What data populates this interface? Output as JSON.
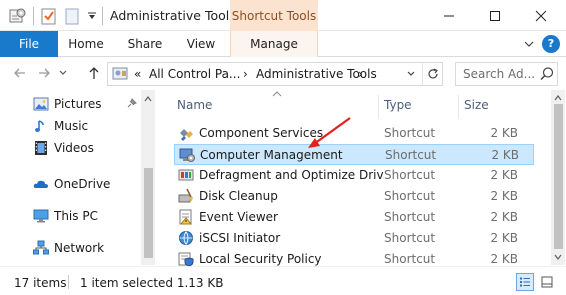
{
  "titlebar": {
    "window_title": "Administrative Tools",
    "contextual_tab": "Shortcut Tools",
    "icons": [
      "properties-icon",
      "checkmark-icon",
      "new-folder-icon",
      "dropdown-arrow-icon"
    ],
    "window_controls": [
      "minimize-icon",
      "maximize-icon",
      "close-icon"
    ]
  },
  "ribbon": {
    "tabs": [
      "File",
      "Home",
      "Share",
      "View",
      "Manage"
    ],
    "help_label": "?"
  },
  "address": {
    "overflow": "«",
    "crumbs": [
      "All Control Pa...",
      "Administrative Tools"
    ],
    "separator": "›",
    "search_placeholder": "Search Ad..."
  },
  "nav_pane": {
    "items": [
      {
        "label": "Pictures",
        "icon": "pictures-icon",
        "pinned": true
      },
      {
        "label": "Music",
        "icon": "music-icon",
        "pinned": false
      },
      {
        "label": "Videos",
        "icon": "videos-icon",
        "pinned": false
      },
      {
        "label": "OneDrive",
        "icon": "onedrive-icon",
        "pinned": false
      },
      {
        "label": "This PC",
        "icon": "this-pc-icon",
        "pinned": false
      },
      {
        "label": "Network",
        "icon": "network-icon",
        "pinned": false
      }
    ]
  },
  "file_list": {
    "columns": [
      "Name",
      "Type",
      "Size"
    ],
    "rows": [
      {
        "name": "Component Services",
        "type": "Shortcut",
        "size": "2 KB",
        "icon": "component-services-icon",
        "selected": false
      },
      {
        "name": "Computer Management",
        "type": "Shortcut",
        "size": "2 KB",
        "icon": "computer-management-icon",
        "selected": true
      },
      {
        "name": "Defragment and Optimize Driv...",
        "type": "Shortcut",
        "size": "2 KB",
        "icon": "defragment-icon",
        "selected": false
      },
      {
        "name": "Disk Cleanup",
        "type": "Shortcut",
        "size": "2 KB",
        "icon": "disk-cleanup-icon",
        "selected": false
      },
      {
        "name": "Event Viewer",
        "type": "Shortcut",
        "size": "2 KB",
        "icon": "event-viewer-icon",
        "selected": false
      },
      {
        "name": "iSCSI Initiator",
        "type": "Shortcut",
        "size": "2 KB",
        "icon": "iscsi-initiator-icon",
        "selected": false
      },
      {
        "name": "Local Security Policy",
        "type": "Shortcut",
        "size": "2 KB",
        "icon": "local-security-policy-icon",
        "selected": false
      }
    ]
  },
  "status": {
    "item_count": "17 items",
    "selection": "1 item selected  1.13 KB",
    "views": [
      "details-view-icon",
      "large-icons-view-icon"
    ]
  },
  "colors": {
    "accent": "#1979ca",
    "selection_fill": "#cce8ff",
    "selection_border": "#99d1ff",
    "contextual_tab": "#fbe3d0",
    "annotation_arrow": "#e0231b"
  }
}
